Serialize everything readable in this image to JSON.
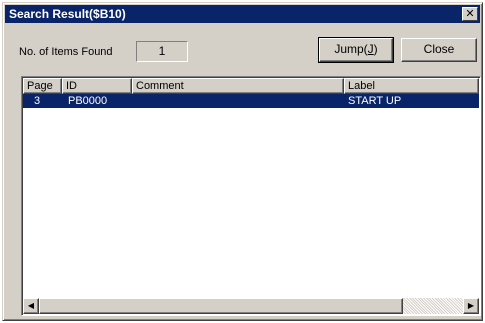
{
  "window": {
    "title": "Search Result($B10)",
    "close_glyph": "✕"
  },
  "summary": {
    "items_found_label": "No. of Items Found",
    "items_found_value": "1"
  },
  "buttons": {
    "jump_label": "Jump(",
    "jump_mnemonic": "J",
    "jump_label_end": ")",
    "close_label": "Close"
  },
  "list": {
    "columns": [
      "Page",
      "ID",
      "Comment",
      "Label"
    ],
    "rows": [
      {
        "page": "3",
        "id": "PB0000",
        "comment": "",
        "label": "START UP",
        "selected": true
      }
    ]
  },
  "scrollbar": {
    "left_arrow": "◀",
    "right_arrow": "▶"
  },
  "colors": {
    "titlebar": "#0a246a",
    "selection": "#0a246a",
    "face": "#d4d0c8"
  }
}
